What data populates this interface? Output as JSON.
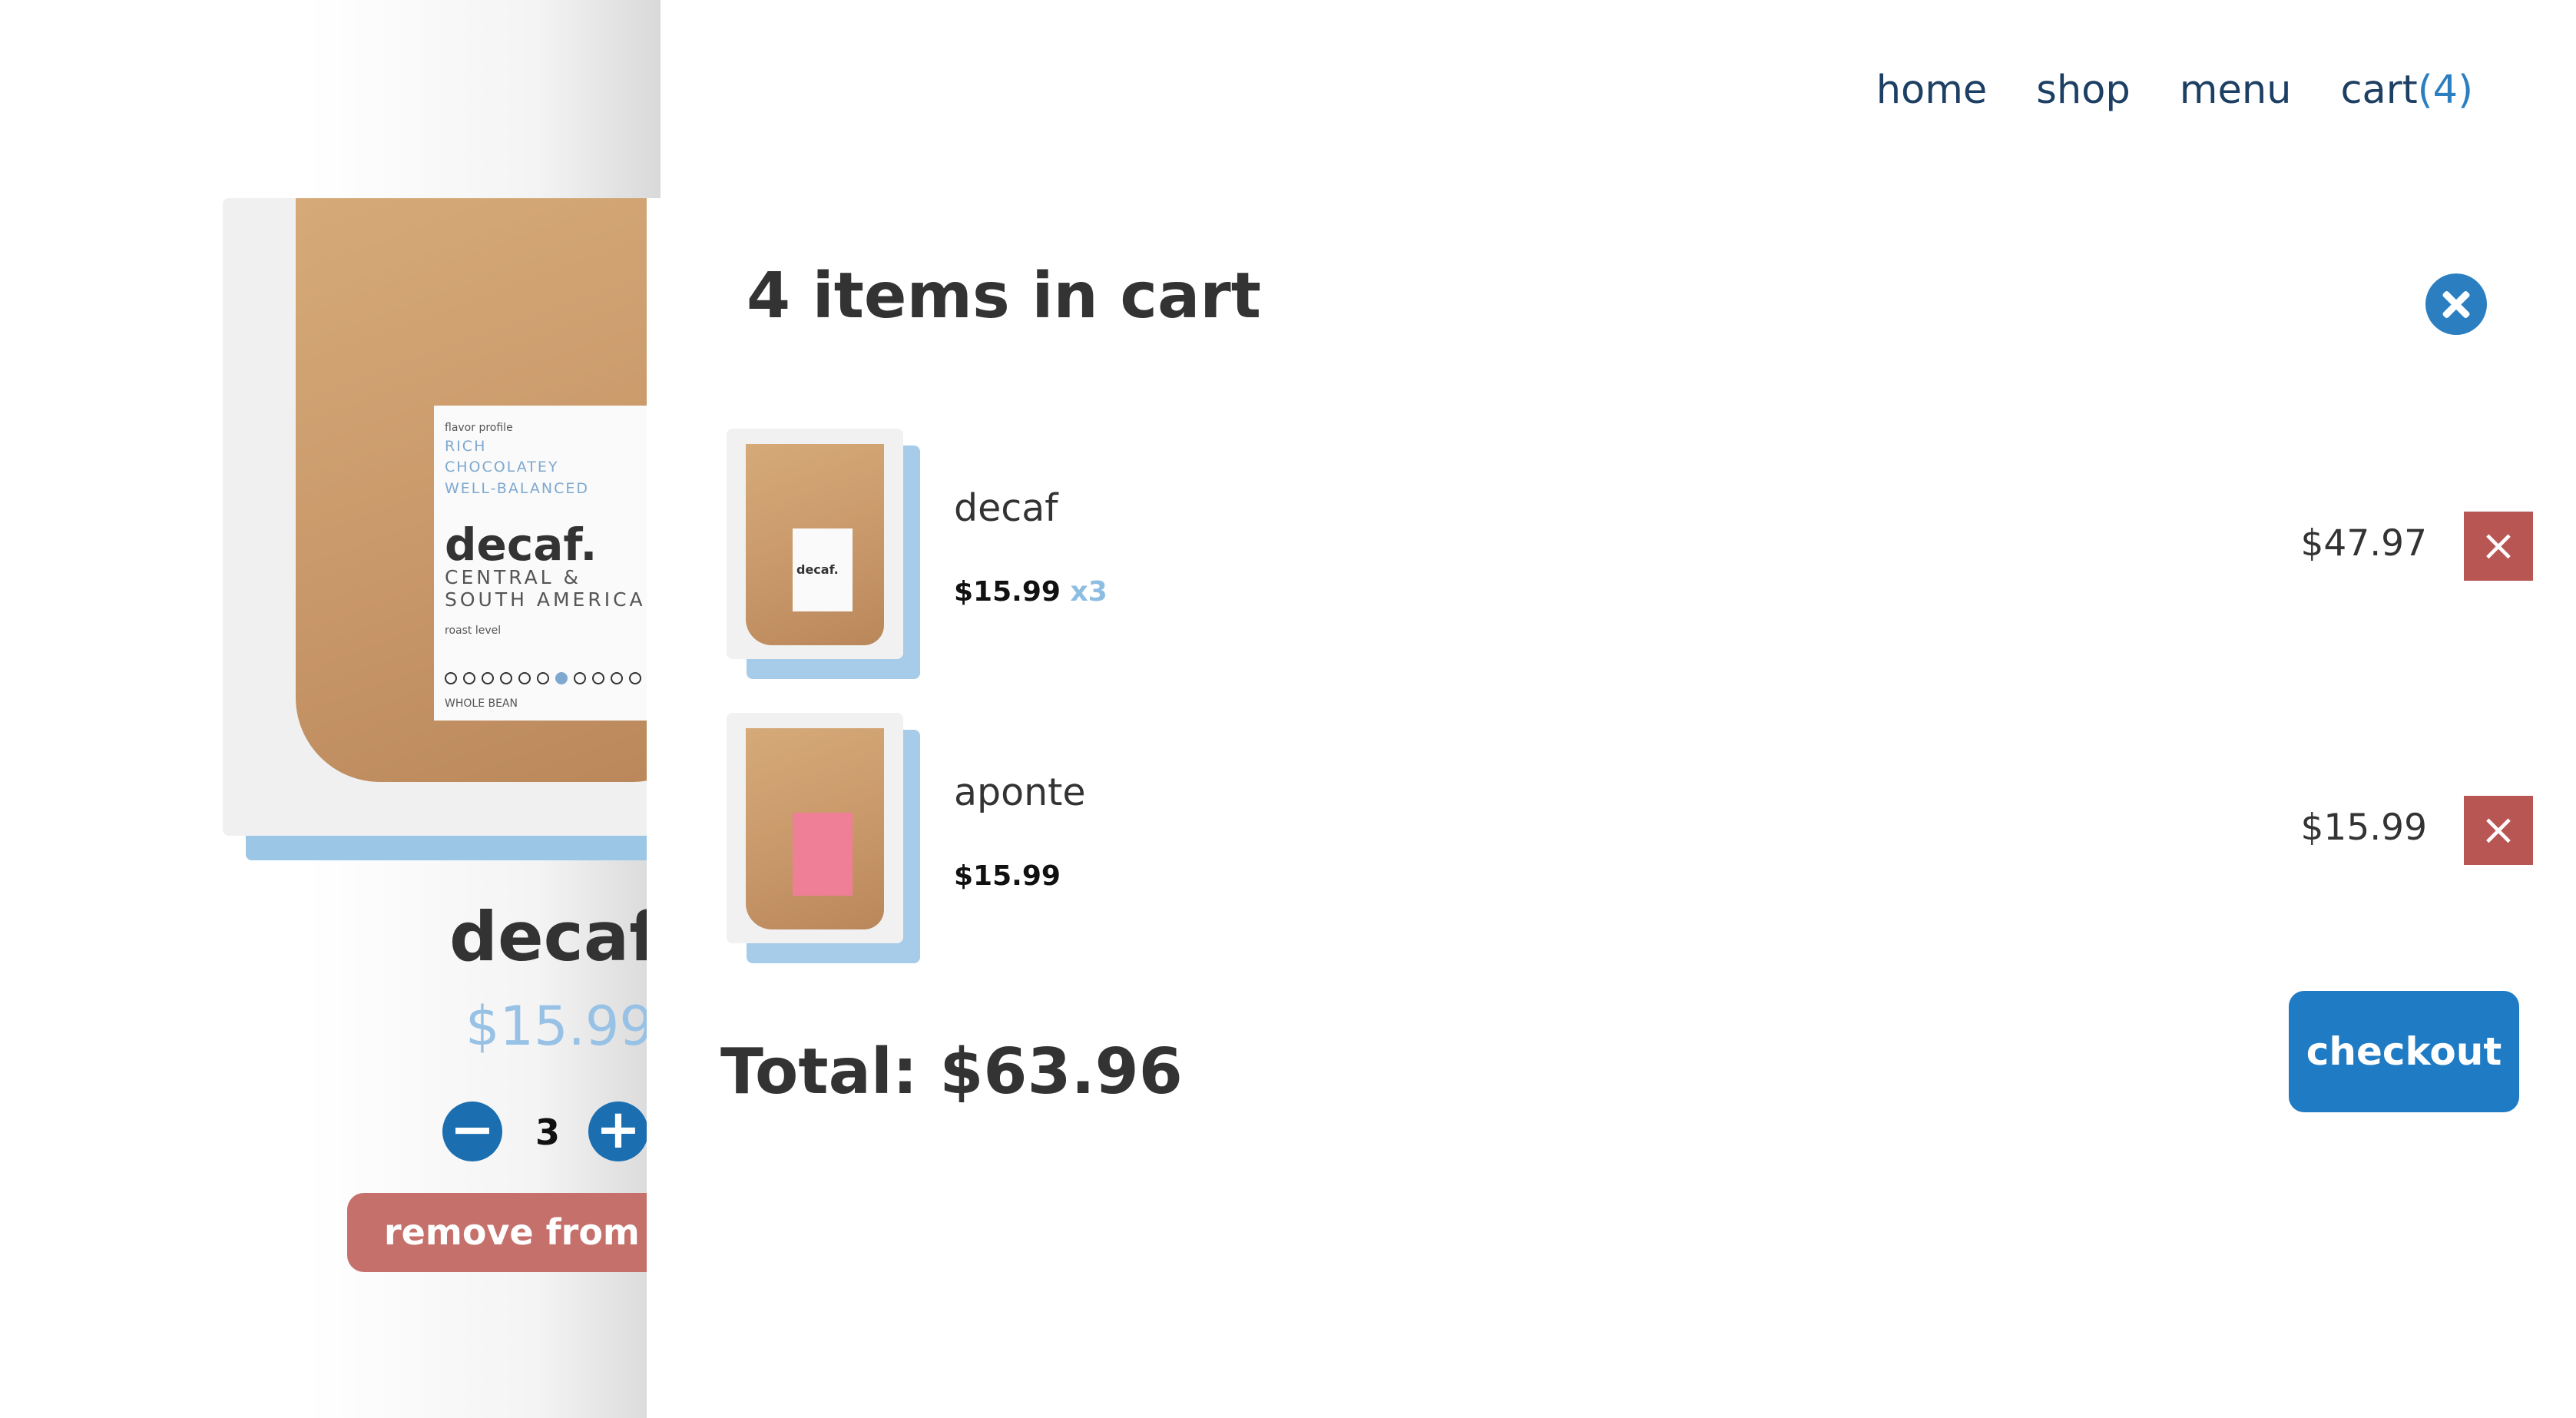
{
  "nav": {
    "items": [
      "home",
      "shop",
      "menu"
    ],
    "cart_label": "cart",
    "cart_count": "(4)"
  },
  "product": {
    "name": "decaf",
    "price": "$15.99",
    "quantity": "3",
    "remove_label": "remove from c",
    "bag_label": {
      "flavor_title": "flavor profile",
      "flavor_notes": [
        "RICH",
        "CHOCOLATEY",
        "WELL-BALANCED"
      ],
      "name": "decaf.",
      "origin": [
        "CENTRAL &",
        "SOUTH AMERICA"
      ],
      "roast_title": "roast level",
      "bean": "WHOLE BEAN"
    }
  },
  "cart": {
    "title": "4 items in cart",
    "items": [
      {
        "name": "decaf",
        "unit_price": "$15.99",
        "qty": "x3",
        "line_total": "$47.97"
      },
      {
        "name": "aponte",
        "unit_price": "$15.99",
        "qty": "",
        "line_total": "$15.99"
      }
    ],
    "total": "Total: $63.96",
    "checkout_label": "checkout",
    "remove_icon": "×"
  },
  "colors": {
    "brand_blue": "#2b7fc1",
    "nav_text": "#1c3f63",
    "remove_red": "#b85653",
    "price_light_blue": "#98c2e5"
  }
}
